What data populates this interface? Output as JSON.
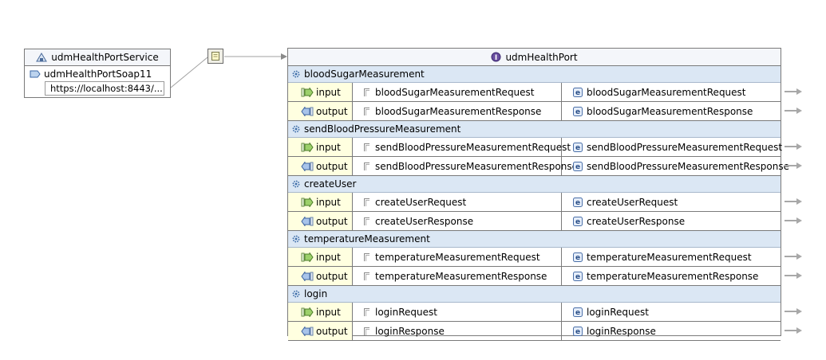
{
  "service": {
    "name": "udmHealthPortService",
    "port_name": "udmHealthPortSoap11",
    "address": "https://localhost:8443/..."
  },
  "port_type": {
    "name": "udmHealthPort"
  },
  "direction_labels": {
    "input": "input",
    "output": "output"
  },
  "operations": [
    {
      "name": "bloodSugarMeasurement",
      "input_part": "bloodSugarMeasurementRequest",
      "input_element": "bloodSugarMeasurementRequest",
      "output_part": "bloodSugarMeasurementResponse",
      "output_element": "bloodSugarMeasurementResponse"
    },
    {
      "name": "sendBloodPressureMeasurement",
      "input_part": "sendBloodPressureMeasurementRequest",
      "input_element": "sendBloodPressureMeasurementRequest",
      "output_part": "sendBloodPressureMeasurementResponse",
      "output_element": "sendBloodPressureMeasurementResponse"
    },
    {
      "name": "createUser",
      "input_part": "createUserRequest",
      "input_element": "createUserRequest",
      "output_part": "createUserResponse",
      "output_element": "createUserResponse"
    },
    {
      "name": "temperatureMeasurement",
      "input_part": "temperatureMeasurementRequest",
      "input_element": "temperatureMeasurementRequest",
      "output_part": "temperatureMeasurementResponse",
      "output_element": "temperatureMeasurementResponse"
    },
    {
      "name": "login",
      "input_part": "loginRequest",
      "input_element": "loginRequest",
      "output_part": "loginResponse",
      "output_element": "loginResponse"
    }
  ]
}
